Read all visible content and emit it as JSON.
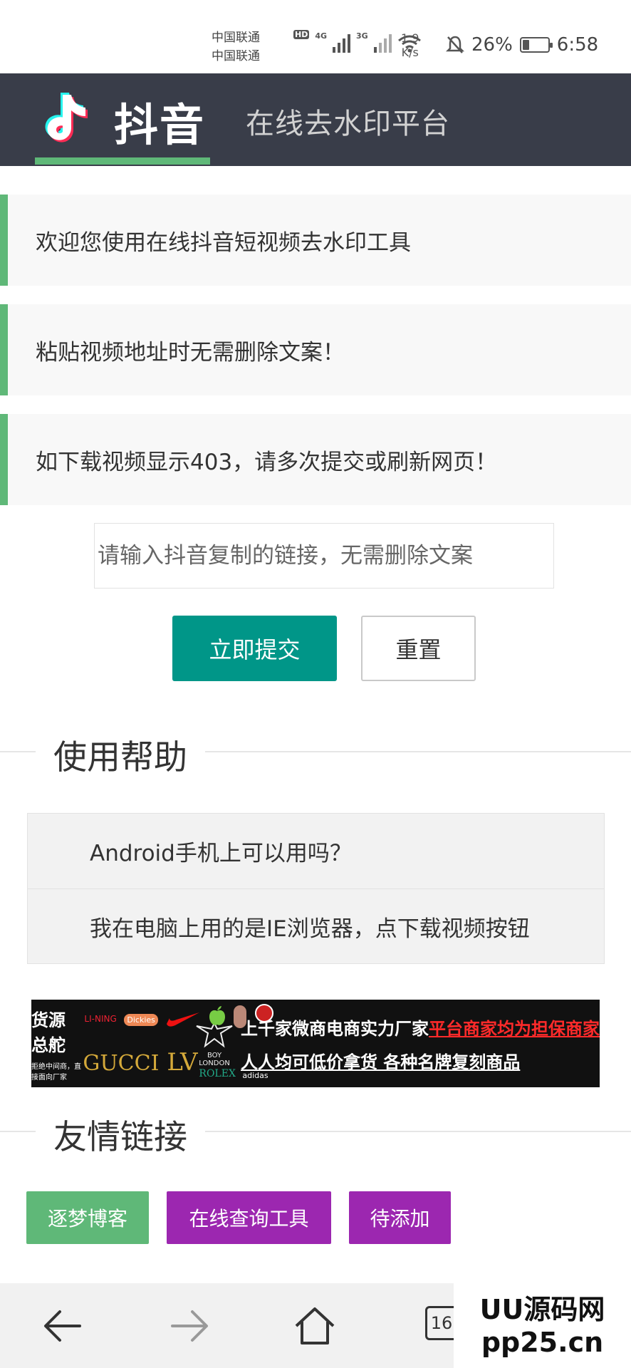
{
  "status_bar": {
    "carrier_1": "中国联通",
    "carrier_2": "中国联通",
    "hd_tag": "HD",
    "net_1": "4G",
    "net_2": "3G",
    "speed_value": "1.9",
    "speed_unit": "K/s",
    "battery_text": "26%",
    "battery_level": 0.26,
    "time": "6:58"
  },
  "header": {
    "logo_text": "抖音",
    "title": "在线去水印平台"
  },
  "notices": [
    "欢迎您使用在线抖音短视频去水印工具",
    "粘贴视频地址时无需删除文案！",
    "如下载视频显示403，请多次提交或刷新网页！"
  ],
  "form": {
    "url_placeholder": "请输入抖音复制的链接，无需删除文案",
    "submit_label": "立即提交",
    "reset_label": "重置"
  },
  "help": {
    "title": "使用帮助",
    "items": [
      "Android手机上可以用吗？",
      "我在电脑上用的是IE浏览器，点下载视频按钮"
    ]
  },
  "banner": {
    "brand_name": "货源总舵",
    "brand_sub": "拒绝中间商，直接面向厂家",
    "logos": [
      "LI-NING",
      "Dickies",
      "GUCCI",
      "ROLEX",
      "adidas",
      "BOY LONDON"
    ],
    "line1_prefix": "上千家微商电商实力厂家",
    "line1_highlight": "平台商家均为担保商家",
    "line2": "人人均可低价拿货 各种名牌复刻商品"
  },
  "links": {
    "title": "友情链接",
    "items": [
      {
        "label": "逐梦博客",
        "color": "#5fb878"
      },
      {
        "label": "在线查询工具",
        "color": "#9c27b0"
      },
      {
        "label": "待添加",
        "color": "#9c27b0"
      }
    ]
  },
  "browser_nav": {
    "tab_count": "16"
  },
  "watermark": {
    "line1": "UU源码网",
    "line2": "pp25.cn"
  },
  "colors": {
    "header_bg": "#393d49",
    "accent_green": "#5fb878",
    "submit_teal": "#009688"
  }
}
